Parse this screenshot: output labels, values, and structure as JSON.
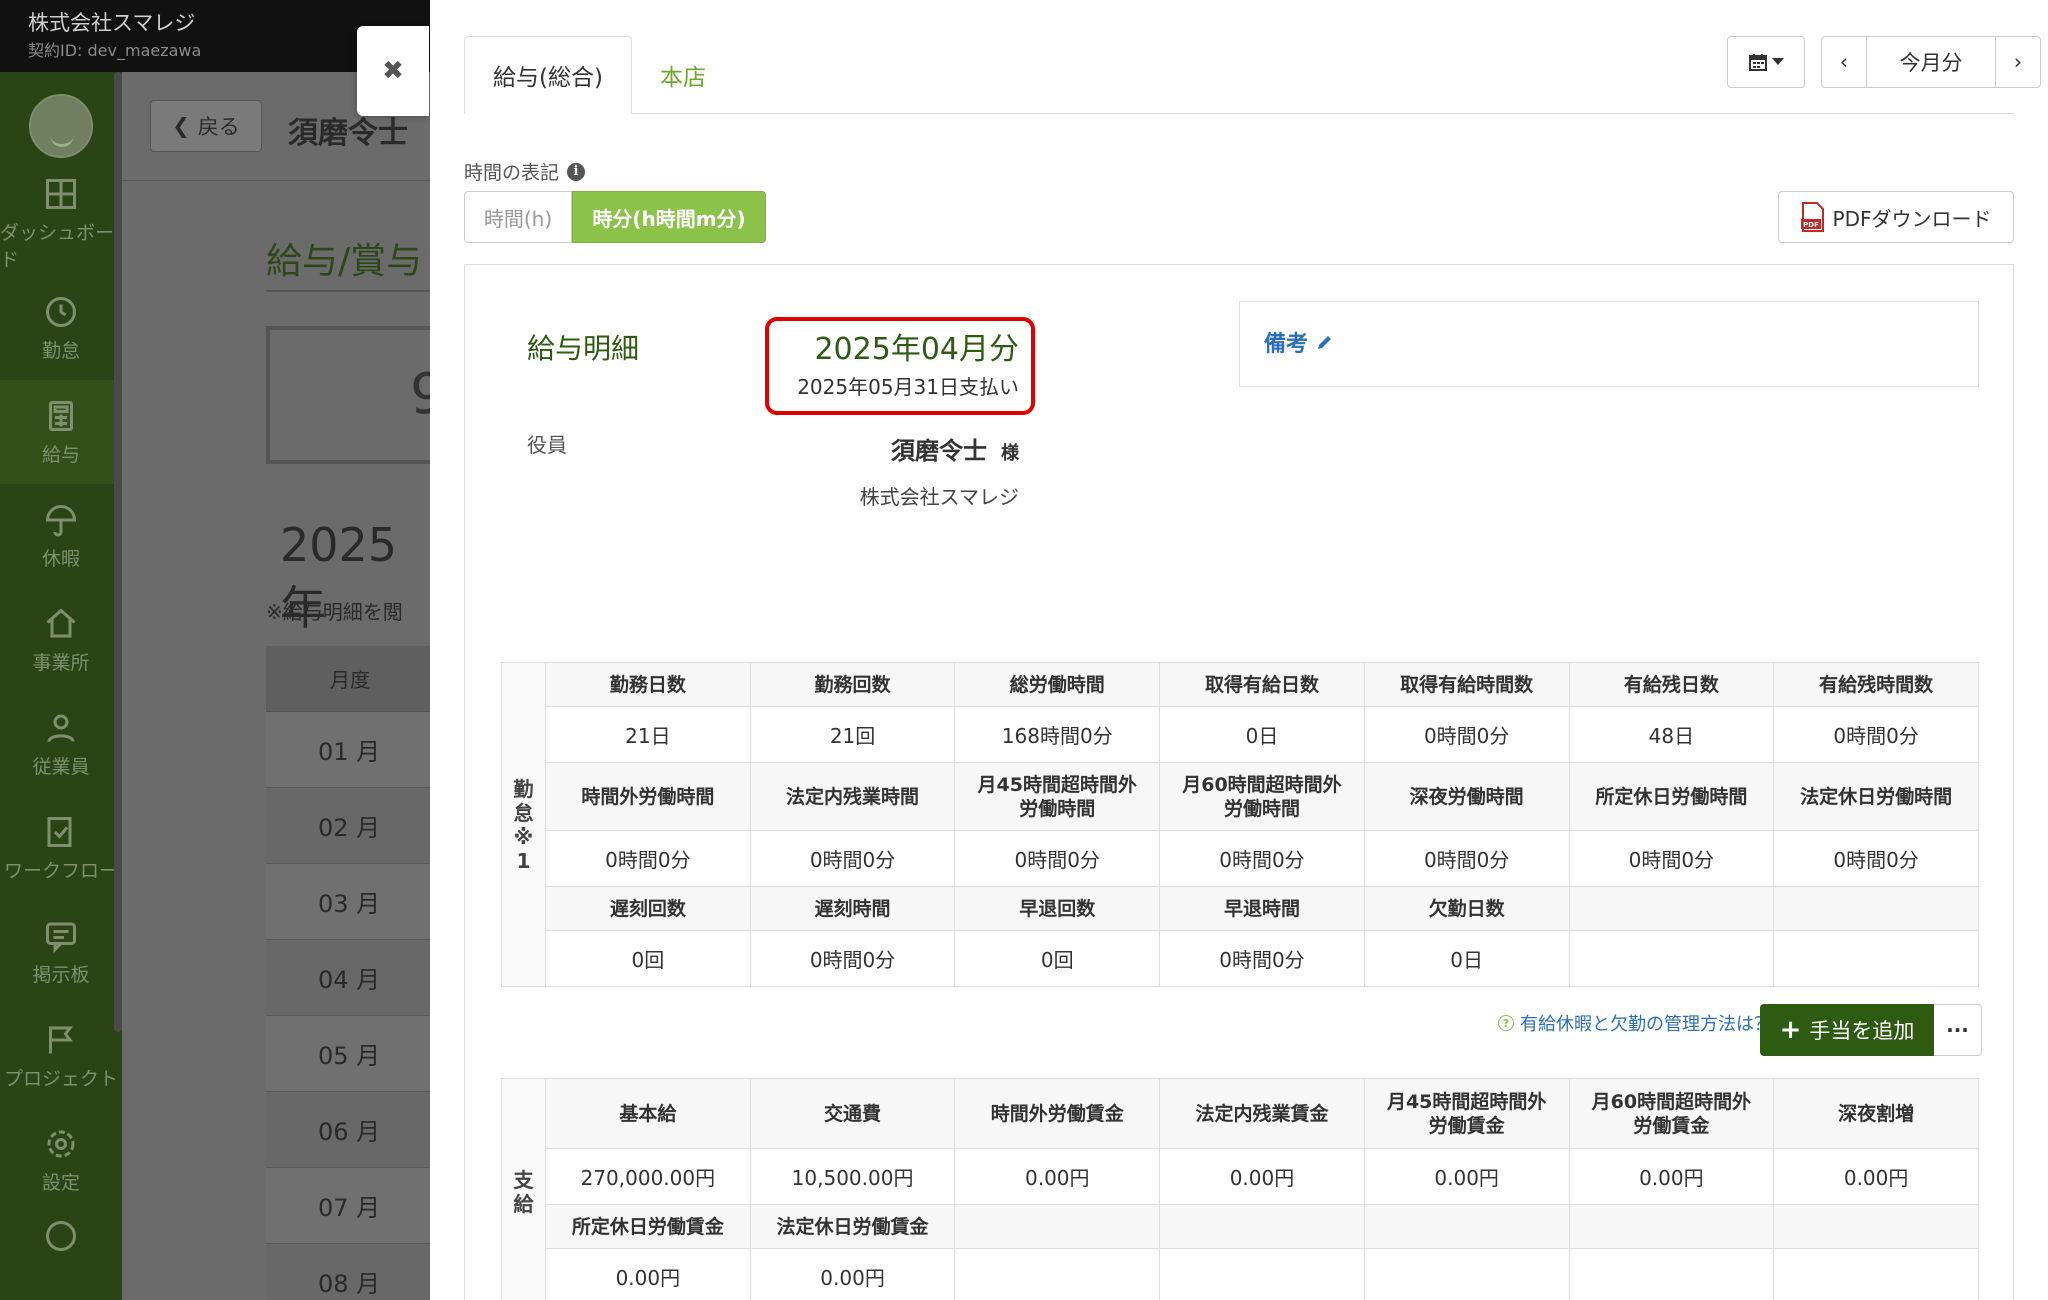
{
  "topbar": {
    "company": "株式会社スマレジ",
    "contract_id": "契約ID: dev_maezawa"
  },
  "sidebar": {
    "items": [
      {
        "label": "ダッシュボード",
        "icon": "dashboard-icon"
      },
      {
        "label": "勤怠",
        "icon": "clock-icon"
      },
      {
        "label": "給与",
        "icon": "calculator-icon"
      },
      {
        "label": "休暇",
        "icon": "umbrella-icon"
      },
      {
        "label": "事業所",
        "icon": "home-icon"
      },
      {
        "label": "従業員",
        "icon": "user-icon"
      },
      {
        "label": "ワークフロー",
        "icon": "workflow-icon"
      },
      {
        "label": "掲示板",
        "icon": "message-icon"
      },
      {
        "label": "プロジェクト",
        "icon": "flag-icon"
      },
      {
        "label": "設定",
        "icon": "gear-icon"
      }
    ],
    "help_icon": "?"
  },
  "background": {
    "back_label": "戻る",
    "person_name": "須磨令士",
    "section_title": "給与/賞与",
    "summary_digit": "9",
    "big_year": "2025年",
    "note": "※給与明細を閲",
    "month_header": "月度",
    "months": [
      "01 月",
      "02 月",
      "03 月",
      "04 月",
      "05 月",
      "06 月",
      "07 月",
      "08 月"
    ]
  },
  "panel": {
    "close_glyph": "✖",
    "tabs": [
      {
        "label": "給与(総合)",
        "active": true
      },
      {
        "label": "本店",
        "active": false
      }
    ],
    "nav": {
      "prev": "‹",
      "this_month": "今月分",
      "next": "›"
    },
    "time_notation": {
      "label": "時間の表記",
      "options": [
        {
          "label": "時間(h)",
          "selected": false
        },
        {
          "label": "時分(h時間m分)",
          "selected": true
        }
      ]
    },
    "pdf_download": "PDFダウンロード"
  },
  "payslip": {
    "title": "給与明細",
    "period": "2025年04月分",
    "pay_date": "2025年05月31日支払い",
    "role": "役員",
    "employee_name": "須磨令士",
    "honorific": "様",
    "company": "株式会社スマレジ",
    "remarks_label": "備考"
  },
  "attendance": {
    "side_label": "勤\n怠\n※\n1",
    "row1_headers": [
      "勤務日数",
      "勤務回数",
      "総労働時間",
      "取得有給日数",
      "取得有給時間数",
      "有給残日数",
      "有給残時間数"
    ],
    "row1_values": [
      "21日",
      "21回",
      "168時間0分",
      "0日",
      "0時間0分",
      "48日",
      "0時間0分"
    ],
    "row2_headers": [
      "時間外労働時間",
      "法定内残業時間",
      "月45時間超時間外\n労働時間",
      "月60時間超時間外\n労働時間",
      "深夜労働時間",
      "所定休日労働時間",
      "法定休日労働時間"
    ],
    "row2_values": [
      "0時間0分",
      "0時間0分",
      "0時間0分",
      "0時間0分",
      "0時間0分",
      "0時間0分",
      "0時間0分"
    ],
    "row3_headers": [
      "遅刻回数",
      "遅刻時間",
      "早退回数",
      "早退時間",
      "欠勤日数",
      "",
      ""
    ],
    "row3_values": [
      "0回",
      "0時間0分",
      "0回",
      "0時間0分",
      "0日",
      "",
      ""
    ]
  },
  "actions": {
    "help_link": "有給休暇と欠勤の管理方法は？",
    "add_allowance": "手当を追加",
    "more": "···"
  },
  "payment": {
    "side_label": "支\n給",
    "row1_headers": [
      "基本給",
      "交通費",
      "時間外労働賃金",
      "法定内残業賃金",
      "月45時間超時間外\n労働賃金",
      "月60時間超時間外\n労働賃金",
      "深夜割増"
    ],
    "row1_values": [
      "270,000.00円",
      "10,500.00円",
      "0.00円",
      "0.00円",
      "0.00円",
      "0.00円",
      "0.00円"
    ],
    "row2_headers": [
      "所定休日労働賃金",
      "法定休日労働賃金",
      "",
      "",
      "",
      "",
      ""
    ],
    "row2_values": [
      "0.00円",
      "0.00円",
      "",
      "",
      "",
      "",
      ""
    ]
  },
  "colors": {
    "accent_green": "#8bc34a",
    "dark_green": "#2e5b12",
    "highlight_red": "#e00000",
    "link_blue": "#2a6fbd"
  }
}
